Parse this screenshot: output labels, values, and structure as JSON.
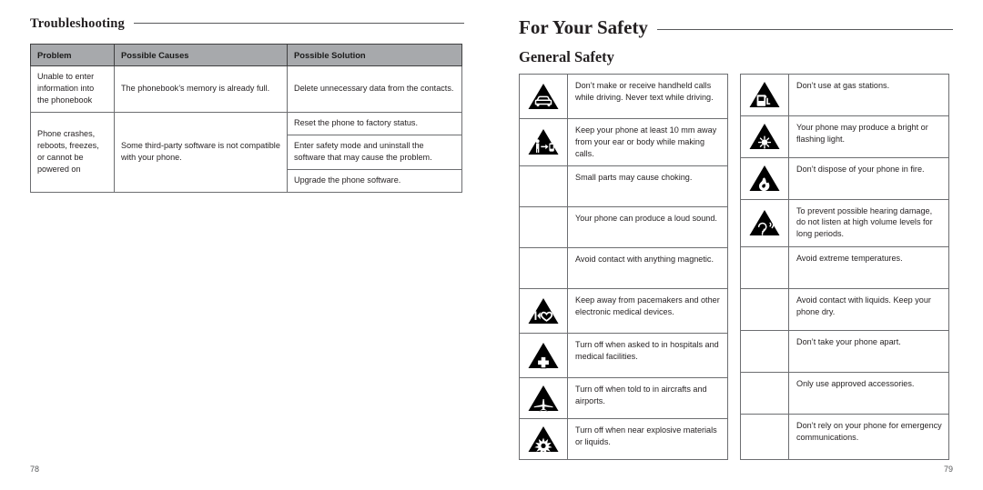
{
  "left_page": {
    "running_head": "Troubleshooting",
    "folio": "78",
    "troubleshooting_table": {
      "headers": [
        "Problem",
        "Possible Causes",
        "Possible Solution"
      ],
      "rows": [
        {
          "problem": "Unable to enter information into the phonebook",
          "cause": "The phonebook’s memory is already full.",
          "solutions": [
            "Delete unnecessary data from the contacts."
          ]
        },
        {
          "problem": "Phone crashes, reboots, freezes, or cannot be powered on",
          "cause": "Some third-party software is not compatible with your phone.",
          "solutions": [
            "Reset the phone to factory status.",
            "Enter safety mode and uninstall the software that may cause the problem.",
            "Upgrade the phone software."
          ]
        }
      ]
    }
  },
  "right_page": {
    "chapter_title": "For Your Safety",
    "section_title": "General Safety",
    "folio": "79",
    "safety_table_left": [
      {
        "icon": "car-warning-icon",
        "text": "Don’t make or receive handheld calls while driving. Never text while driving."
      },
      {
        "icon": "body-distance-warning-icon",
        "text": "Keep your phone at least 10 mm away from your ear or body while making calls."
      },
      {
        "icon": "none",
        "text": "Small parts may cause choking."
      },
      {
        "icon": "none",
        "text": "Your phone can produce a loud sound."
      },
      {
        "icon": "none",
        "text": "Avoid contact with anything magnetic."
      },
      {
        "icon": "pacemaker-warning-icon",
        "text": "Keep away from pacemakers and other electronic medical devices."
      },
      {
        "icon": "hospital-warning-icon",
        "text": "Turn off when asked to in hospitals and medical facilities."
      },
      {
        "icon": "aircraft-warning-icon",
        "text": "Turn off when told to in aircrafts and airports."
      },
      {
        "icon": "explosive-warning-icon",
        "text": "Turn off when near explosive materials or liquids."
      }
    ],
    "safety_table_right": [
      {
        "icon": "gas-station-warning-icon",
        "text": "Don’t use at gas stations."
      },
      {
        "icon": "bright-light-warning-icon",
        "text": "Your phone may produce a bright or flashing light."
      },
      {
        "icon": "fire-warning-icon",
        "text": "Don’t dispose of your phone in fire."
      },
      {
        "icon": "hearing-warning-icon",
        "text": "To prevent possible hearing damage, do not listen at high volume levels for long periods."
      },
      {
        "icon": "none",
        "text": "Avoid extreme temperatures."
      },
      {
        "icon": "none",
        "text": "Avoid contact with liquids. Keep your phone dry."
      },
      {
        "icon": "none",
        "text": "Don’t take your phone apart."
      },
      {
        "icon": "none",
        "text": "Only use approved accessories."
      },
      {
        "icon": "none",
        "text": "Don’t rely on your phone for emergency communications."
      }
    ]
  },
  "colors": {
    "header_fill": "#a7a9ac",
    "border": "#6d6e71",
    "text": "#231f20",
    "icon_fill": "#000000"
  }
}
